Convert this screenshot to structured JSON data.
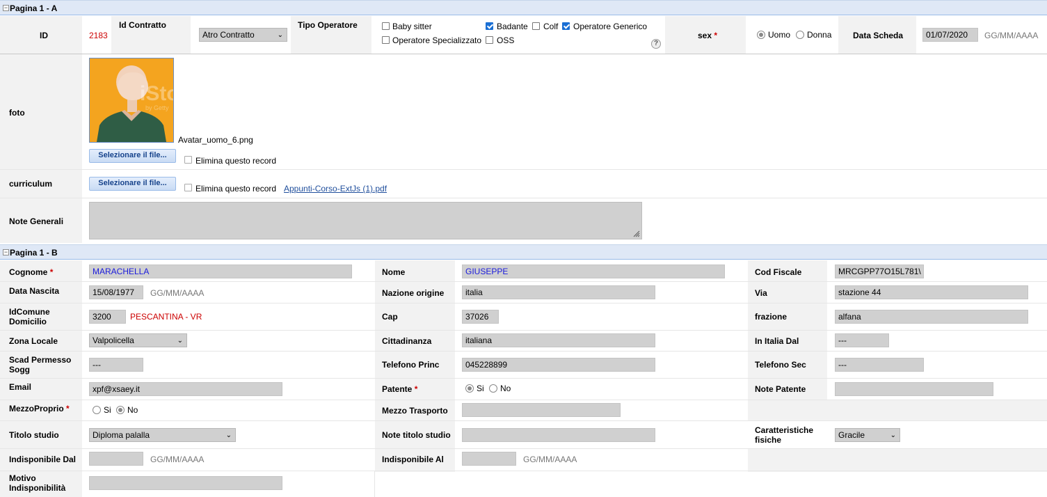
{
  "section_a": {
    "title": "Pagina 1 - A",
    "toggle": "−"
  },
  "section_b": {
    "title": "Pagina 1 - B",
    "toggle": "−"
  },
  "header": {
    "id_label": "ID",
    "id_value": "2183",
    "contract_label": "Id Contratto",
    "contract_value": "Atro Contratto",
    "operator_label": "Tipo Operatore",
    "operators": [
      {
        "label": "Baby sitter",
        "checked": false
      },
      {
        "label": "Badante",
        "checked": true
      },
      {
        "label": "Colf",
        "checked": false
      },
      {
        "label": "Operatore Generico",
        "checked": true
      },
      {
        "label": "Operatore Specializzato",
        "checked": false
      },
      {
        "label": "OSS",
        "checked": false
      }
    ],
    "help_icon": "?",
    "sex_label": "sex",
    "sex_required": "*",
    "sex_options": [
      "Uomo",
      "Donna"
    ],
    "sex_selected": "Uomo",
    "date_label": "Data Scheda",
    "date_value": "01/07/2020",
    "date_hint": "GG/MM/AAAA"
  },
  "foto": {
    "label": "foto",
    "filename": "Avatar_uomo_6.png",
    "button": "Selezionare il file...",
    "delete_label": "Elimina questo record",
    "watermark": "iSto",
    "watermark_sub": "by Getty"
  },
  "curriculum": {
    "label": "curriculum",
    "button": "Selezionare il file...",
    "delete_label": "Elimina questo record",
    "file_link": "Appunti-Corso-ExtJs (1).pdf"
  },
  "note_generali": {
    "label": "Note Generali",
    "value": ""
  },
  "fields": {
    "cognome": {
      "label": "Cognome",
      "req": "*",
      "value": "MARACHELLA"
    },
    "nome": {
      "label": "Nome",
      "value": "GIUSEPPE"
    },
    "cod_fiscale": {
      "label": "Cod Fiscale",
      "value": "MRCGPP77O15L781\\"
    },
    "data_nascita": {
      "label": "Data Nascita",
      "value": "15/08/1977",
      "hint": "GG/MM/AAAA"
    },
    "nazione": {
      "label": "Nazione origine",
      "value": "italia"
    },
    "via": {
      "label": "Via",
      "value": "stazione 44"
    },
    "idcomune": {
      "label1": "IdComune",
      "label2": "Domicilio",
      "value": "3200",
      "name": "PESCANTINA - VR"
    },
    "cap": {
      "label": "Cap",
      "value": "37026"
    },
    "frazione": {
      "label": "frazione",
      "value": "alfana"
    },
    "zona": {
      "label": "Zona Locale",
      "value": "Valpolicella"
    },
    "cittadinanza": {
      "label": "Cittadinanza",
      "value": "italiana"
    },
    "in_italia": {
      "label": "In Italia Dal",
      "value": "---"
    },
    "scad_permesso": {
      "label1": "Scad Permesso",
      "label2": "Sogg",
      "value": "---"
    },
    "tel_princ": {
      "label": "Telefono Princ",
      "value": "045228899"
    },
    "tel_sec": {
      "label": "Telefono Sec",
      "value": "---"
    },
    "email": {
      "label": "Email",
      "value": "xpf@xsaey.it"
    },
    "patente": {
      "label": "Patente",
      "req": "*",
      "options": [
        "Si",
        "No"
      ],
      "selected": "Si"
    },
    "note_patente": {
      "label": "Note Patente",
      "value": ""
    },
    "mezzo_proprio": {
      "label": "MezzoProprio",
      "req": "*",
      "options": [
        "Si",
        "No"
      ],
      "selected": "No"
    },
    "mezzo_trasporto": {
      "label": "Mezzo Trasporto",
      "value": ""
    },
    "titolo": {
      "label": "Titolo studio",
      "value": "Diploma palalla"
    },
    "note_titolo": {
      "label": "Note titolo studio",
      "value": ""
    },
    "caratteristiche": {
      "label1": "Caratteristiche",
      "label2": "fisiche",
      "value": "Gracile"
    },
    "indisp_dal": {
      "label": "Indisponibile Dal",
      "value": "",
      "hint": "GG/MM/AAAA"
    },
    "indisp_al": {
      "label": "Indisponibile Al",
      "value": "",
      "hint": "GG/MM/AAAA"
    },
    "motivo": {
      "label1": "Motivo",
      "label2": "Indisponibilità",
      "value": ""
    }
  }
}
